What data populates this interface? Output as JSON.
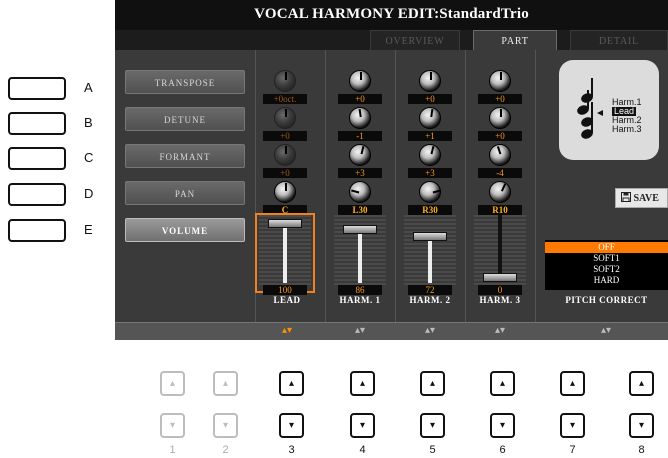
{
  "side_buttons": [
    {
      "label": "A"
    },
    {
      "label": "B"
    },
    {
      "label": "C"
    },
    {
      "label": "D"
    },
    {
      "label": "E"
    }
  ],
  "screen": {
    "title": "VOCAL HARMONY EDIT:",
    "title_file": "StandardTrio",
    "tabs": [
      {
        "label": "OVERVIEW",
        "active": false
      },
      {
        "label": "PART",
        "active": true
      },
      {
        "label": "DETAIL",
        "active": false
      }
    ],
    "params": [
      {
        "label": "TRANSPOSE",
        "active": false
      },
      {
        "label": "DETUNE",
        "active": false
      },
      {
        "label": "FORMANT",
        "active": false
      },
      {
        "label": "PAN",
        "active": false
      },
      {
        "label": "VOLUME",
        "active": true
      }
    ],
    "channels": [
      {
        "name": "LEAD",
        "transpose": "+0oct.",
        "detune": "+0",
        "formant": "+0",
        "pan": "C",
        "volume": "100",
        "selected": true
      },
      {
        "name": "HARM. 1",
        "transpose": "+0",
        "detune": "-1",
        "formant": "+3",
        "pan": "L30",
        "volume": "86",
        "selected": false
      },
      {
        "name": "HARM. 2",
        "transpose": "+0",
        "detune": "+1",
        "formant": "+3",
        "pan": "R30",
        "volume": "72",
        "selected": false
      },
      {
        "name": "HARM. 3",
        "transpose": "+0",
        "detune": "+0",
        "formant": "-4",
        "pan": "R10",
        "volume": "0",
        "selected": false
      }
    ],
    "harmony_labels": [
      "Harm.1",
      "Lead",
      "Harm.2",
      "Harm.3"
    ],
    "save_label": "SAVE",
    "pitch_correct": {
      "label": "PITCH CORRECT",
      "options": [
        "OFF",
        "SOFT1",
        "SOFT2",
        "HARD"
      ],
      "selected": "OFF"
    },
    "accent_color": "#ff8a00"
  },
  "bottom_buttons": [
    {
      "number": "1",
      "enabled": false
    },
    {
      "number": "2",
      "enabled": false
    },
    {
      "number": "3",
      "enabled": true
    },
    {
      "number": "4",
      "enabled": true
    },
    {
      "number": "5",
      "enabled": true
    },
    {
      "number": "6",
      "enabled": true
    },
    {
      "number": "7",
      "enabled": true
    },
    {
      "number": "8",
      "enabled": true
    }
  ],
  "icons": {
    "up": "up-triangle-icon",
    "down": "down-triangle-icon",
    "save": "floppy-disk-icon",
    "music": "music-notes-icon"
  }
}
